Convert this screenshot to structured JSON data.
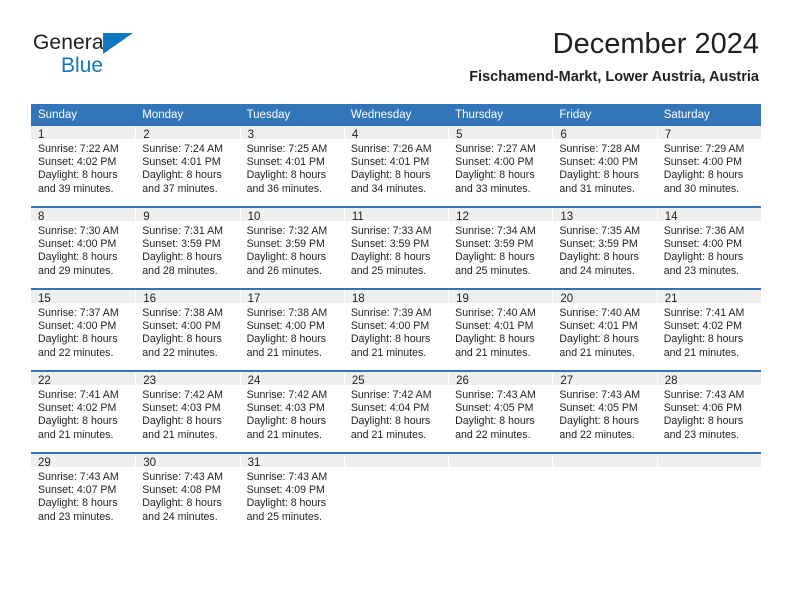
{
  "brand": {
    "name_top": "General",
    "name_bottom": "Blue",
    "triangle_color": "#1277bc"
  },
  "header": {
    "title": "December 2024",
    "subtitle": "Fischamend-Markt, Lower Austria, Austria"
  },
  "theme": {
    "header_blue": "#3275b8",
    "daynum_band": "#efefef",
    "text": "#231f20"
  },
  "calendar": {
    "weekday_headers": [
      "Sunday",
      "Monday",
      "Tuesday",
      "Wednesday",
      "Thursday",
      "Friday",
      "Saturday"
    ],
    "weeks": [
      [
        {
          "day": "1",
          "sunrise": "Sunrise: 7:22 AM",
          "sunset": "Sunset: 4:02 PM",
          "daylight_line1": "Daylight: 8 hours",
          "daylight_line2": "and 39 minutes."
        },
        {
          "day": "2",
          "sunrise": "Sunrise: 7:24 AM",
          "sunset": "Sunset: 4:01 PM",
          "daylight_line1": "Daylight: 8 hours",
          "daylight_line2": "and 37 minutes."
        },
        {
          "day": "3",
          "sunrise": "Sunrise: 7:25 AM",
          "sunset": "Sunset: 4:01 PM",
          "daylight_line1": "Daylight: 8 hours",
          "daylight_line2": "and 36 minutes."
        },
        {
          "day": "4",
          "sunrise": "Sunrise: 7:26 AM",
          "sunset": "Sunset: 4:01 PM",
          "daylight_line1": "Daylight: 8 hours",
          "daylight_line2": "and 34 minutes."
        },
        {
          "day": "5",
          "sunrise": "Sunrise: 7:27 AM",
          "sunset": "Sunset: 4:00 PM",
          "daylight_line1": "Daylight: 8 hours",
          "daylight_line2": "and 33 minutes."
        },
        {
          "day": "6",
          "sunrise": "Sunrise: 7:28 AM",
          "sunset": "Sunset: 4:00 PM",
          "daylight_line1": "Daylight: 8 hours",
          "daylight_line2": "and 31 minutes."
        },
        {
          "day": "7",
          "sunrise": "Sunrise: 7:29 AM",
          "sunset": "Sunset: 4:00 PM",
          "daylight_line1": "Daylight: 8 hours",
          "daylight_line2": "and 30 minutes."
        }
      ],
      [
        {
          "day": "8",
          "sunrise": "Sunrise: 7:30 AM",
          "sunset": "Sunset: 4:00 PM",
          "daylight_line1": "Daylight: 8 hours",
          "daylight_line2": "and 29 minutes."
        },
        {
          "day": "9",
          "sunrise": "Sunrise: 7:31 AM",
          "sunset": "Sunset: 3:59 PM",
          "daylight_line1": "Daylight: 8 hours",
          "daylight_line2": "and 28 minutes."
        },
        {
          "day": "10",
          "sunrise": "Sunrise: 7:32 AM",
          "sunset": "Sunset: 3:59 PM",
          "daylight_line1": "Daylight: 8 hours",
          "daylight_line2": "and 26 minutes."
        },
        {
          "day": "11",
          "sunrise": "Sunrise: 7:33 AM",
          "sunset": "Sunset: 3:59 PM",
          "daylight_line1": "Daylight: 8 hours",
          "daylight_line2": "and 25 minutes."
        },
        {
          "day": "12",
          "sunrise": "Sunrise: 7:34 AM",
          "sunset": "Sunset: 3:59 PM",
          "daylight_line1": "Daylight: 8 hours",
          "daylight_line2": "and 25 minutes."
        },
        {
          "day": "13",
          "sunrise": "Sunrise: 7:35 AM",
          "sunset": "Sunset: 3:59 PM",
          "daylight_line1": "Daylight: 8 hours",
          "daylight_line2": "and 24 minutes."
        },
        {
          "day": "14",
          "sunrise": "Sunrise: 7:36 AM",
          "sunset": "Sunset: 4:00 PM",
          "daylight_line1": "Daylight: 8 hours",
          "daylight_line2": "and 23 minutes."
        }
      ],
      [
        {
          "day": "15",
          "sunrise": "Sunrise: 7:37 AM",
          "sunset": "Sunset: 4:00 PM",
          "daylight_line1": "Daylight: 8 hours",
          "daylight_line2": "and 22 minutes."
        },
        {
          "day": "16",
          "sunrise": "Sunrise: 7:38 AM",
          "sunset": "Sunset: 4:00 PM",
          "daylight_line1": "Daylight: 8 hours",
          "daylight_line2": "and 22 minutes."
        },
        {
          "day": "17",
          "sunrise": "Sunrise: 7:38 AM",
          "sunset": "Sunset: 4:00 PM",
          "daylight_line1": "Daylight: 8 hours",
          "daylight_line2": "and 21 minutes."
        },
        {
          "day": "18",
          "sunrise": "Sunrise: 7:39 AM",
          "sunset": "Sunset: 4:00 PM",
          "daylight_line1": "Daylight: 8 hours",
          "daylight_line2": "and 21 minutes."
        },
        {
          "day": "19",
          "sunrise": "Sunrise: 7:40 AM",
          "sunset": "Sunset: 4:01 PM",
          "daylight_line1": "Daylight: 8 hours",
          "daylight_line2": "and 21 minutes."
        },
        {
          "day": "20",
          "sunrise": "Sunrise: 7:40 AM",
          "sunset": "Sunset: 4:01 PM",
          "daylight_line1": "Daylight: 8 hours",
          "daylight_line2": "and 21 minutes."
        },
        {
          "day": "21",
          "sunrise": "Sunrise: 7:41 AM",
          "sunset": "Sunset: 4:02 PM",
          "daylight_line1": "Daylight: 8 hours",
          "daylight_line2": "and 21 minutes."
        }
      ],
      [
        {
          "day": "22",
          "sunrise": "Sunrise: 7:41 AM",
          "sunset": "Sunset: 4:02 PM",
          "daylight_line1": "Daylight: 8 hours",
          "daylight_line2": "and 21 minutes."
        },
        {
          "day": "23",
          "sunrise": "Sunrise: 7:42 AM",
          "sunset": "Sunset: 4:03 PM",
          "daylight_line1": "Daylight: 8 hours",
          "daylight_line2": "and 21 minutes."
        },
        {
          "day": "24",
          "sunrise": "Sunrise: 7:42 AM",
          "sunset": "Sunset: 4:03 PM",
          "daylight_line1": "Daylight: 8 hours",
          "daylight_line2": "and 21 minutes."
        },
        {
          "day": "25",
          "sunrise": "Sunrise: 7:42 AM",
          "sunset": "Sunset: 4:04 PM",
          "daylight_line1": "Daylight: 8 hours",
          "daylight_line2": "and 21 minutes."
        },
        {
          "day": "26",
          "sunrise": "Sunrise: 7:43 AM",
          "sunset": "Sunset: 4:05 PM",
          "daylight_line1": "Daylight: 8 hours",
          "daylight_line2": "and 22 minutes."
        },
        {
          "day": "27",
          "sunrise": "Sunrise: 7:43 AM",
          "sunset": "Sunset: 4:05 PM",
          "daylight_line1": "Daylight: 8 hours",
          "daylight_line2": "and 22 minutes."
        },
        {
          "day": "28",
          "sunrise": "Sunrise: 7:43 AM",
          "sunset": "Sunset: 4:06 PM",
          "daylight_line1": "Daylight: 8 hours",
          "daylight_line2": "and 23 minutes."
        }
      ],
      [
        {
          "day": "29",
          "sunrise": "Sunrise: 7:43 AM",
          "sunset": "Sunset: 4:07 PM",
          "daylight_line1": "Daylight: 8 hours",
          "daylight_line2": "and 23 minutes."
        },
        {
          "day": "30",
          "sunrise": "Sunrise: 7:43 AM",
          "sunset": "Sunset: 4:08 PM",
          "daylight_line1": "Daylight: 8 hours",
          "daylight_line2": "and 24 minutes."
        },
        {
          "day": "31",
          "sunrise": "Sunrise: 7:43 AM",
          "sunset": "Sunset: 4:09 PM",
          "daylight_line1": "Daylight: 8 hours",
          "daylight_line2": "and 25 minutes."
        },
        {
          "day": "",
          "sunrise": "",
          "sunset": "",
          "daylight_line1": "",
          "daylight_line2": ""
        },
        {
          "day": "",
          "sunrise": "",
          "sunset": "",
          "daylight_line1": "",
          "daylight_line2": ""
        },
        {
          "day": "",
          "sunrise": "",
          "sunset": "",
          "daylight_line1": "",
          "daylight_line2": ""
        },
        {
          "day": "",
          "sunrise": "",
          "sunset": "",
          "daylight_line1": "",
          "daylight_line2": ""
        }
      ]
    ]
  }
}
